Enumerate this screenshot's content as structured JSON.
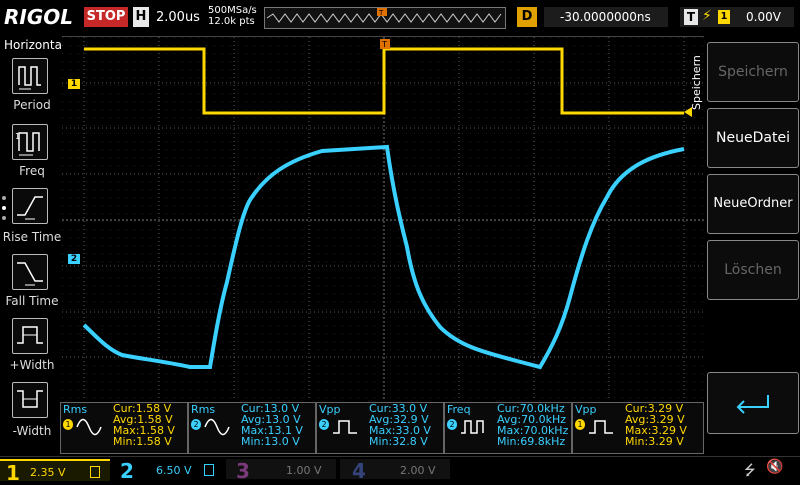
{
  "brand": "RIGOL",
  "run_state": "STOP",
  "timebase": {
    "label": "H",
    "value": "2.00us"
  },
  "sample": {
    "rate": "500MSa/s",
    "points": "12.0k pts"
  },
  "trigger_pos": {
    "label": "D",
    "value": "-30.0000000ns"
  },
  "trigger": {
    "label": "T",
    "source_badge": "1",
    "level": "0.00V"
  },
  "left_panel": {
    "title": "Horizontal",
    "items": [
      "Period",
      "Freq",
      "Rise Time",
      "Fall Time",
      "+Width",
      "-Width"
    ]
  },
  "right_panel": {
    "header": "Speichern",
    "buttons": [
      "Speichern",
      "NeueDatei",
      "NeueOrdner",
      "Löschen"
    ]
  },
  "channels": [
    {
      "num": "1",
      "scale": "2.35 V",
      "color": "#ffd800"
    },
    {
      "num": "2",
      "scale": "6.50 V",
      "color": "#3ad0ff"
    },
    {
      "num": "3",
      "scale": "1.00 V",
      "color": "#c040c0"
    },
    {
      "num": "4",
      "scale": "2.00 V",
      "color": "#3060ff"
    }
  ],
  "markers": {
    "ch1": "1",
    "ch2": "2",
    "trig": "T"
  },
  "measurements": [
    {
      "name": "Rms",
      "ch": "1",
      "cur": "Cur:1.58 V",
      "avg": "Avg:1.58 V",
      "max": "Max:1.58 V",
      "min": "Min:1.58 V"
    },
    {
      "name": "Rms",
      "ch": "2",
      "cur": "Cur:13.0 V",
      "avg": "Avg:13.0 V",
      "max": "Max:13.1 V",
      "min": "Min:13.0 V"
    },
    {
      "name": "Vpp",
      "ch": "2",
      "cur": "Cur:33.0 V",
      "avg": "Avg:32.9 V",
      "max": "Max:33.0 V",
      "min": "Min:32.8 V"
    },
    {
      "name": "Freq",
      "ch": "2",
      "cur": "Cur:70.0kHz",
      "avg": "Avg:70.0kHz",
      "max": "Max:70.0kHz",
      "min": "Min:69.8kHz"
    },
    {
      "name": "Vpp",
      "ch": "1",
      "cur": "Cur:3.29 V",
      "avg": "Avg:3.29 V",
      "max": "Max:3.29 V",
      "min": "Min:3.29 V"
    }
  ],
  "colors": {
    "ch1": "#ffd800",
    "ch2": "#3ad0ff",
    "stop": "#c62828",
    "grid": "#5a5a5a"
  }
}
